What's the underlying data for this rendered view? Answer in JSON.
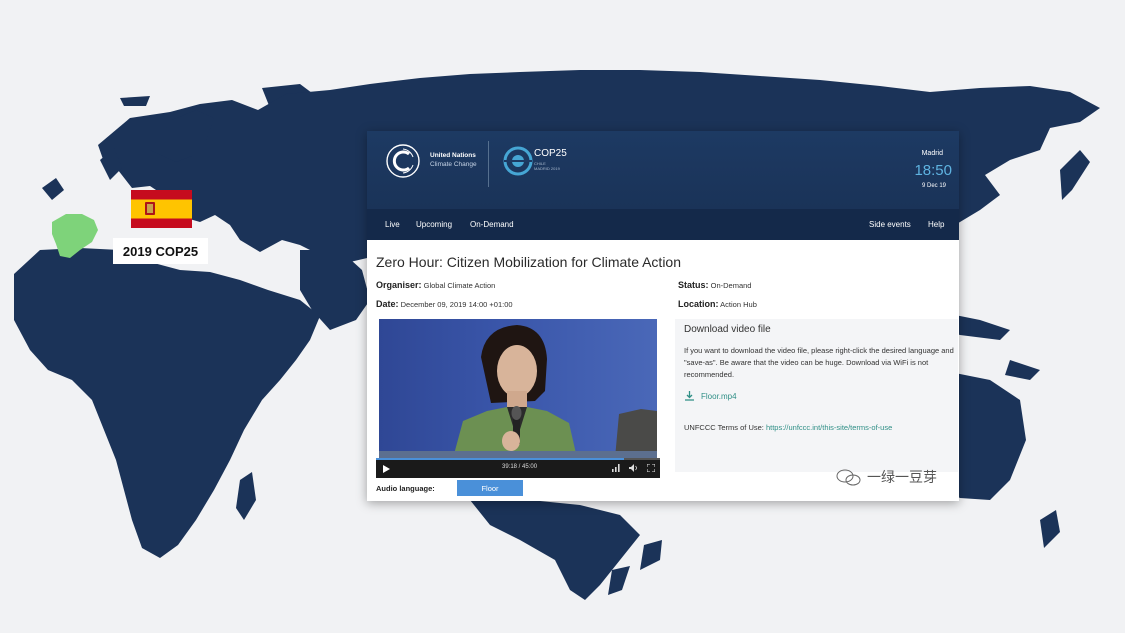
{
  "map": {
    "label": "2019 COP25",
    "ocean_color": "#f1f2f4",
    "land_color": "#1b3358",
    "highlight_color": "#7ed37a",
    "flag_icon": "spain-flag"
  },
  "header": {
    "org_line1": "United Nations",
    "org_line2": "Climate Change",
    "event_logo": "COP25",
    "event_sub_line1": "CHILE",
    "event_sub_line2": "MADRID 2019",
    "city": "Madrid",
    "time": "18:50",
    "date": "9 Dec 19",
    "bg_color": "#1d3a63"
  },
  "nav": {
    "items": [
      "Live",
      "Upcoming",
      "On-Demand"
    ],
    "right_items": [
      "Side events",
      "Help"
    ]
  },
  "session": {
    "title": "Zero Hour: Citizen Mobilization for Climate Action",
    "organiser_label": "Organiser:",
    "organiser_value": "Global Climate Action",
    "date_label": "Date:",
    "date_value": "December 09, 2019 14:00 +01:00",
    "status_label": "Status:",
    "status_value": "On-Demand",
    "location_label": "Location:",
    "location_value": "Action Hub"
  },
  "player": {
    "time": "39:18 / 45:00",
    "progress": 0.873,
    "audio_label": "Audio language:",
    "audio_option": "Floor"
  },
  "download": {
    "heading": "Download video file",
    "instructions": "If you want to download the video file, please right-click the desired language and \"save-as\". Be aware that the video can be huge. Download via WiFi is not recommended.",
    "file_link": "Floor.mp4",
    "terms_label": "UNFCCC Terms of Use:",
    "terms_link": "https://unfccc.int/this-site/terms-of-use"
  },
  "watermark": {
    "text": "一绿一豆芽"
  }
}
